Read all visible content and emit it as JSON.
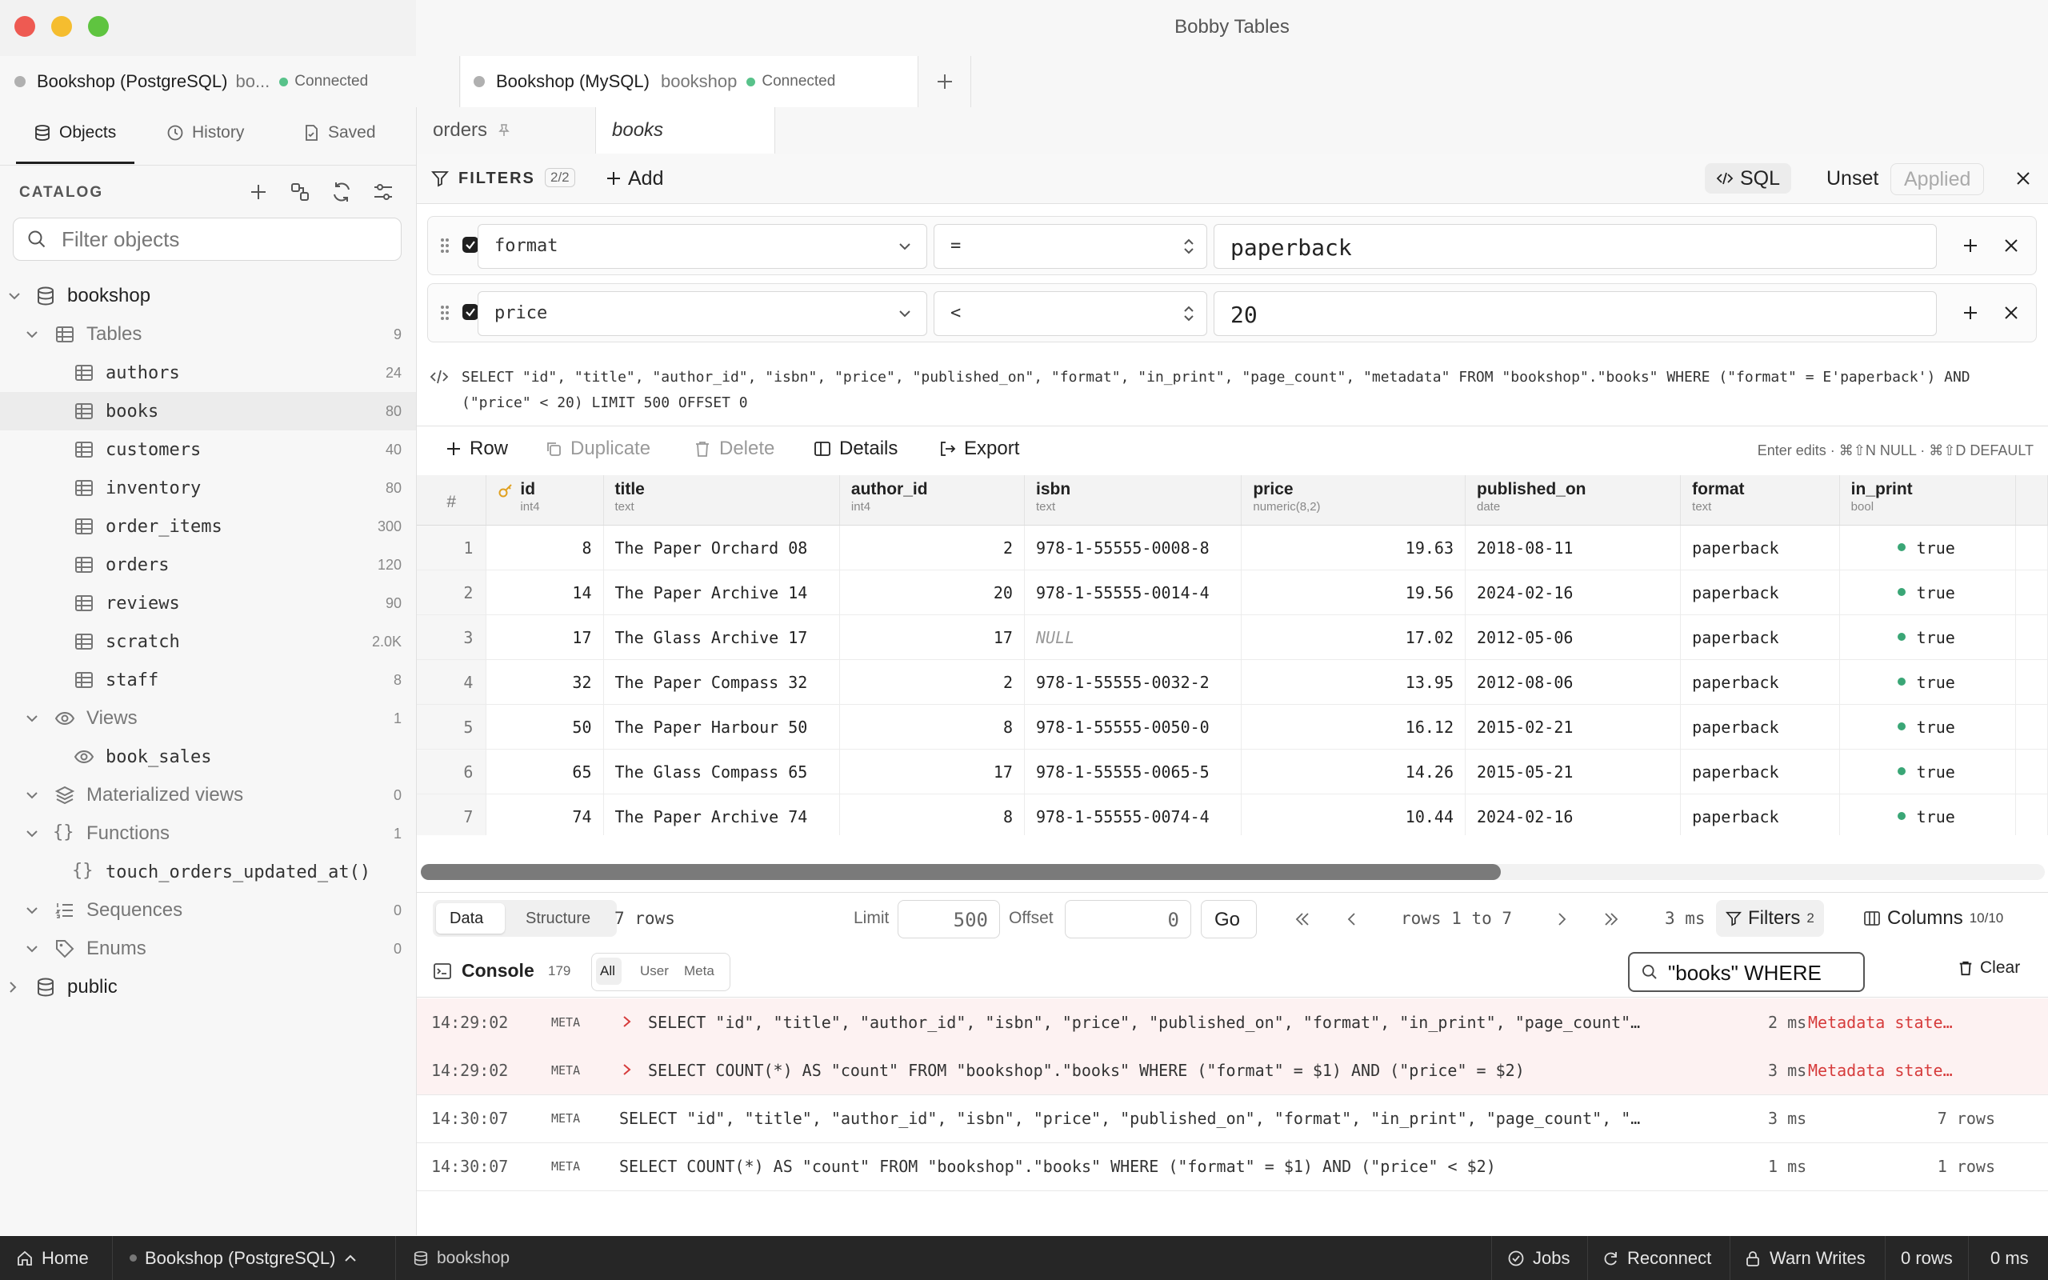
{
  "window": {
    "title": "Bobby Tables"
  },
  "connection_tabs": [
    {
      "name": "Bookshop (PostgreSQL)",
      "db": "bo...",
      "status": "Connected"
    },
    {
      "name": "Bookshop (MySQL)",
      "db": "bookshop",
      "status": "Connected"
    }
  ],
  "sidebar": {
    "tabs": [
      "Objects",
      "History",
      "Saved"
    ],
    "catalog_label": "CATALOG",
    "filter_placeholder": "Filter objects",
    "tree": {
      "database": "bookshop",
      "tables_label": "Tables",
      "tables_count": "9",
      "tables": [
        {
          "name": "authors",
          "count": "24"
        },
        {
          "name": "books",
          "count": "80"
        },
        {
          "name": "customers",
          "count": "40"
        },
        {
          "name": "inventory",
          "count": "80"
        },
        {
          "name": "order_items",
          "count": "300"
        },
        {
          "name": "orders",
          "count": "120"
        },
        {
          "name": "reviews",
          "count": "90"
        },
        {
          "name": "scratch",
          "count": "2.0K"
        },
        {
          "name": "staff",
          "count": "8"
        }
      ],
      "views_label": "Views",
      "views_count": "1",
      "views": [
        "book_sales"
      ],
      "matviews_label": "Materialized views",
      "matviews_count": "0",
      "functions_label": "Functions",
      "functions_count": "1",
      "functions": [
        "touch_orders_updated_at()"
      ],
      "sequences_label": "Sequences",
      "sequences_count": "0",
      "enums_label": "Enums",
      "enums_count": "0",
      "schema2": "public"
    }
  },
  "editor_tabs": [
    "orders",
    "books"
  ],
  "filters": {
    "label": "FILTERS",
    "badge": "2/2",
    "add_label": "Add",
    "sql_label": "SQL",
    "unset_label": "Unset",
    "applied_label": "Applied",
    "rows": [
      {
        "column": "format",
        "operator": "=",
        "value": "paperback"
      },
      {
        "column": "price",
        "operator": "<",
        "value": "20"
      }
    ]
  },
  "sql_preview": "SELECT \"id\", \"title\", \"author_id\", \"isbn\", \"price\", \"published_on\", \"format\", \"in_print\", \"page_count\", \"metadata\" FROM \"bookshop\".\"books\" WHERE (\"format\" = E'paperback') AND (\"price\" < 20) LIMIT 500 OFFSET 0",
  "toolbar": {
    "row": "Row",
    "duplicate": "Duplicate",
    "delete": "Delete",
    "details": "Details",
    "export": "Export",
    "hint": "Enter edits · ⌘⇧N NULL · ⌘⇧D DEFAULT"
  },
  "grid": {
    "rownum_header": "#",
    "columns": [
      {
        "name": "id",
        "type": "int4"
      },
      {
        "name": "title",
        "type": "text"
      },
      {
        "name": "author_id",
        "type": "int4"
      },
      {
        "name": "isbn",
        "type": "text"
      },
      {
        "name": "price",
        "type": "numeric(8,2)"
      },
      {
        "name": "published_on",
        "type": "date"
      },
      {
        "name": "format",
        "type": "text"
      },
      {
        "name": "in_print",
        "type": "bool"
      }
    ],
    "rows": [
      {
        "n": "1",
        "id": "8",
        "title": "The Paper Orchard 08",
        "author_id": "2",
        "isbn": "978-1-55555-0008-8",
        "price": "19.63",
        "published_on": "2018-08-11",
        "format": "paperback",
        "in_print": "true"
      },
      {
        "n": "2",
        "id": "14",
        "title": "The Paper Archive 14",
        "author_id": "20",
        "isbn": "978-1-55555-0014-4",
        "price": "19.56",
        "published_on": "2024-02-16",
        "format": "paperback",
        "in_print": "true"
      },
      {
        "n": "3",
        "id": "17",
        "title": "The Glass Archive 17",
        "author_id": "17",
        "isbn": "NULL",
        "price": "17.02",
        "published_on": "2012-05-06",
        "format": "paperback",
        "in_print": "true"
      },
      {
        "n": "4",
        "id": "32",
        "title": "The Paper Compass 32",
        "author_id": "2",
        "isbn": "978-1-55555-0032-2",
        "price": "13.95",
        "published_on": "2012-08-06",
        "format": "paperback",
        "in_print": "true"
      },
      {
        "n": "5",
        "id": "50",
        "title": "The Paper Harbour 50",
        "author_id": "8",
        "isbn": "978-1-55555-0050-0",
        "price": "16.12",
        "published_on": "2015-02-21",
        "format": "paperback",
        "in_print": "true"
      },
      {
        "n": "6",
        "id": "65",
        "title": "The Glass Compass 65",
        "author_id": "17",
        "isbn": "978-1-55555-0065-5",
        "price": "14.26",
        "published_on": "2015-05-21",
        "format": "paperback",
        "in_print": "true"
      },
      {
        "n": "7",
        "id": "74",
        "title": "The Paper Archive 74",
        "author_id": "8",
        "isbn": "978-1-55555-0074-4",
        "price": "10.44",
        "published_on": "2024-02-16",
        "format": "paperback",
        "in_print": "true"
      }
    ]
  },
  "pager": {
    "data_tab": "Data",
    "structure_tab": "Structure",
    "rows_text": "7 rows",
    "limit_label": "Limit",
    "limit_value": "500",
    "offset_label": "Offset",
    "offset_value": "0",
    "go_label": "Go",
    "range_text": "rows 1 to 7",
    "timing": "3 ms",
    "filters_label": "Filters",
    "filters_count": "2",
    "columns_label": "Columns",
    "columns_count": "10/10"
  },
  "console": {
    "label": "Console",
    "count": "179",
    "chips": [
      "All",
      "User",
      "Meta"
    ],
    "search_value": "\"books\" WHERE",
    "clear_label": "Clear",
    "entries": [
      {
        "time": "14:29:02",
        "kind": "META",
        "sql": "SELECT \"id\", \"title\", \"author_id\", \"isbn\", \"price\", \"published_on\", \"format\", \"in_print\", \"page_count\"…",
        "duration": "2 ms",
        "result": "Metadata state…",
        "error": true
      },
      {
        "time": "14:29:02",
        "kind": "META",
        "sql": "SELECT COUNT(*) AS \"count\" FROM \"bookshop\".\"books\" WHERE (\"format\" = $1) AND (\"price\" = $2)",
        "duration": "3 ms",
        "result": "Metadata state…",
        "error": true
      },
      {
        "time": "14:30:07",
        "kind": "META",
        "sql": "SELECT \"id\", \"title\", \"author_id\", \"isbn\", \"price\", \"published_on\", \"format\", \"in_print\", \"page_count\", \"…",
        "duration": "3 ms",
        "result": "7 rows",
        "error": false
      },
      {
        "time": "14:30:07",
        "kind": "META",
        "sql": "SELECT COUNT(*) AS \"count\" FROM \"bookshop\".\"books\" WHERE (\"format\" = $1) AND (\"price\" < $2)",
        "duration": "1 ms",
        "result": "1 rows",
        "error": false
      }
    ]
  },
  "statusbar": {
    "home": "Home",
    "connection": "Bookshop (PostgreSQL)",
    "database": "bookshop",
    "jobs": "Jobs",
    "reconnect": "Reconnect",
    "warn_writes": "Warn Writes",
    "rows": "0 rows",
    "ms": "0 ms"
  },
  "colors": {
    "connected": "#58c28a",
    "error": "#d63b3b",
    "bool_true": "#3aa676",
    "pk_key": "#e0a020"
  }
}
